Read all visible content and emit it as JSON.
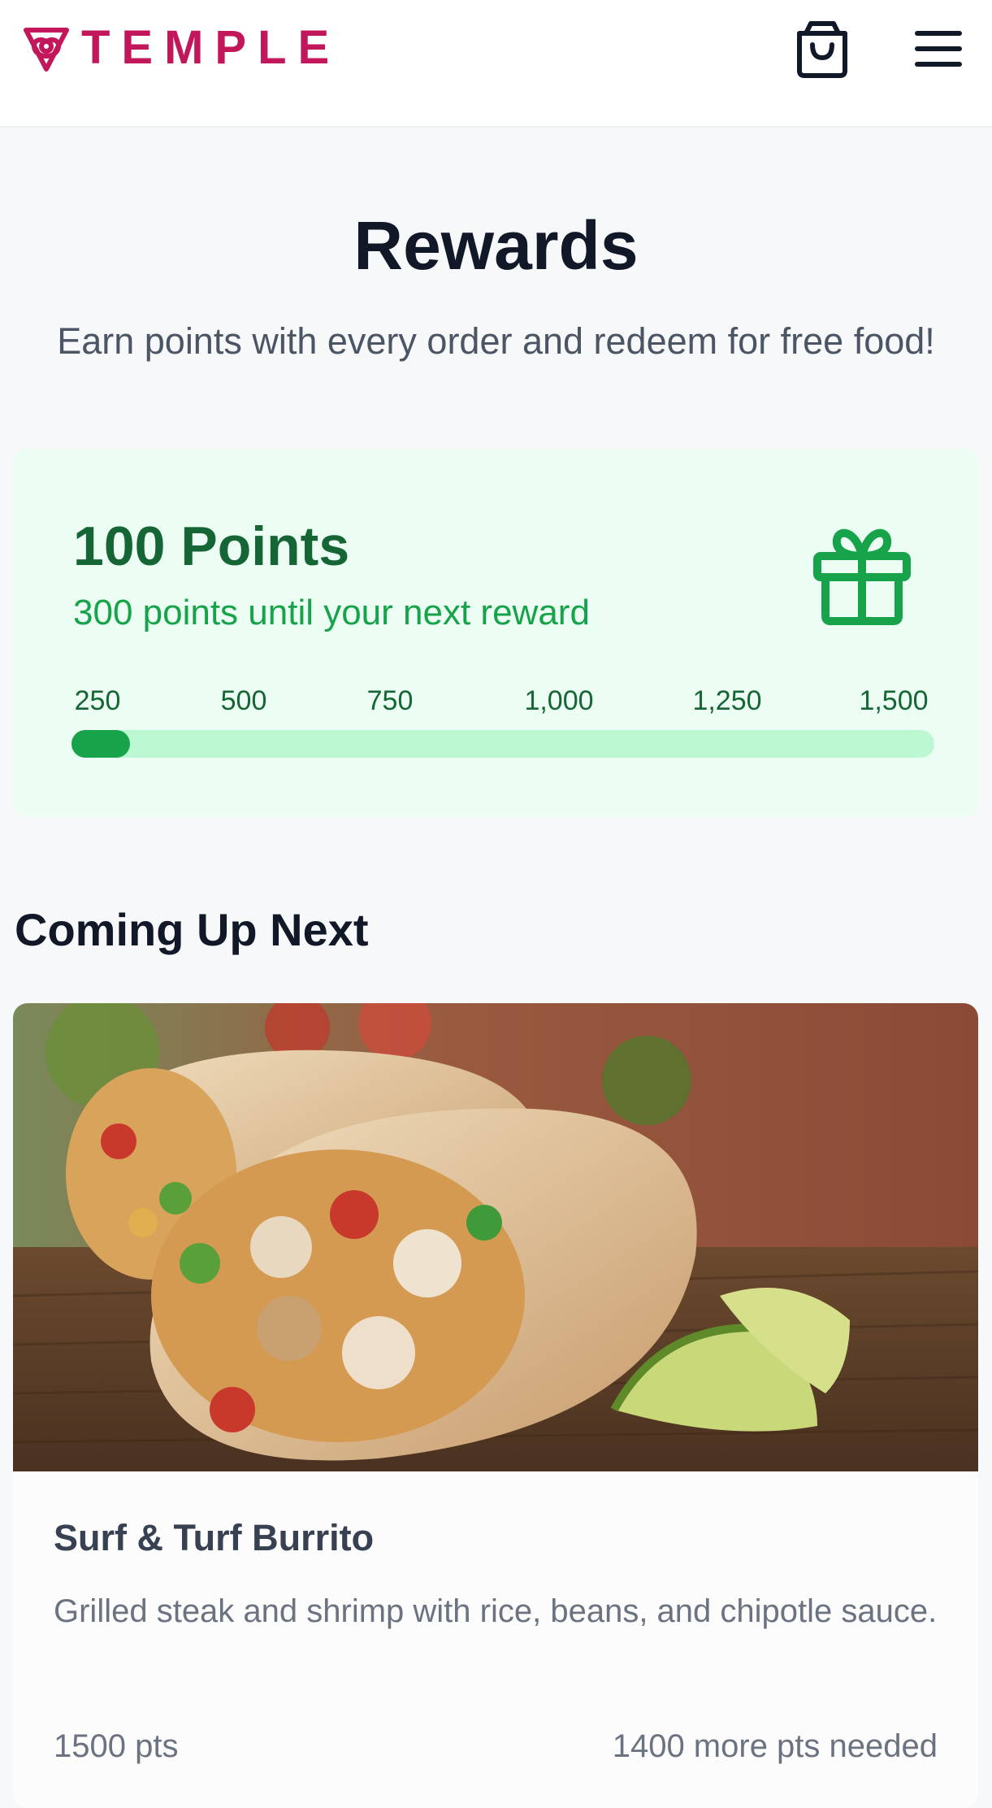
{
  "header": {
    "brand": "TEMPLE",
    "brand_color": "#c2185b",
    "icons": [
      "logo-knot-icon",
      "shopping-bag-icon",
      "hamburger-menu-icon"
    ]
  },
  "page": {
    "title": "Rewards",
    "subtitle": "Earn points with every order and redeem for free food!"
  },
  "points": {
    "value": "100 Points",
    "until_next": "300 points until your next reward",
    "icon": "gift-icon",
    "current": 100,
    "scale": [
      "250",
      "500",
      "750",
      "1,000",
      "1,250",
      "1,500"
    ],
    "progress_fraction": 0.068,
    "colors": {
      "card_bg": "#ecfdf3",
      "track": "#bbf7d0",
      "fill": "#16a34a",
      "text_dark": "#166534"
    }
  },
  "coming_up": {
    "section_title": "Coming Up Next",
    "item": {
      "name": "Surf & Turf Burrito",
      "description": "Grilled steak and shrimp with rice, beans, and chipotle sauce.",
      "points": "1500 pts",
      "needed": "1400 more pts needed"
    }
  }
}
